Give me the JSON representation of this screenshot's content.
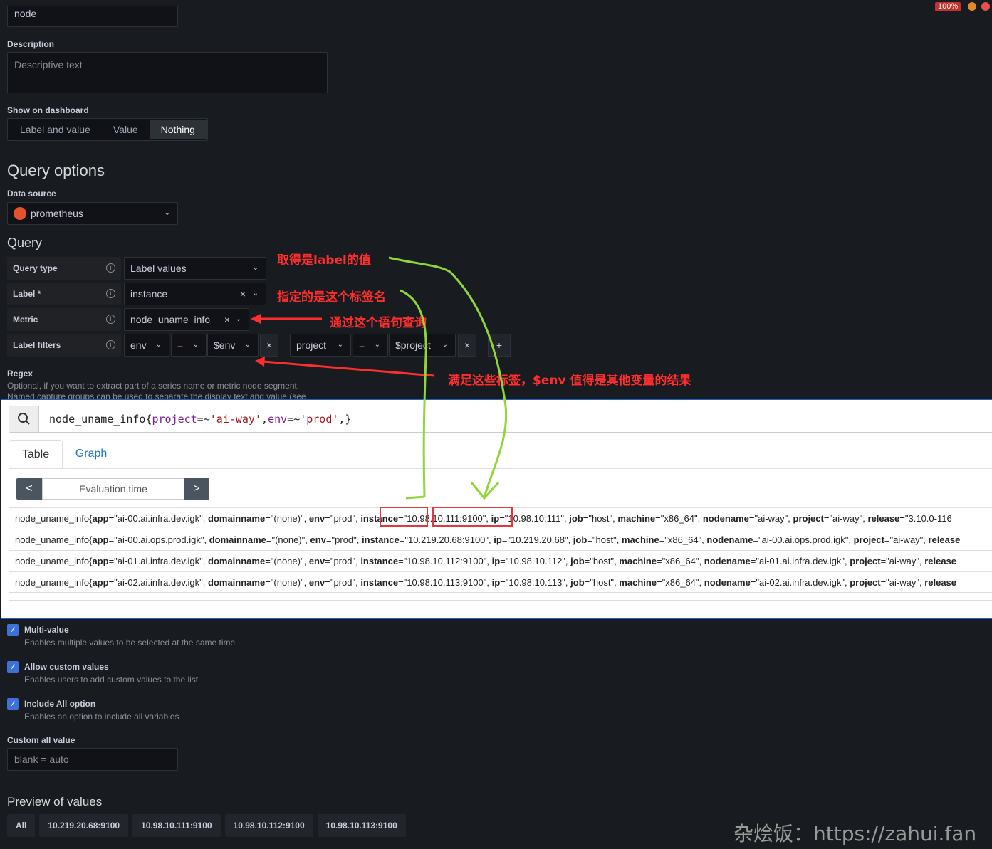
{
  "top": {
    "zoom": "100%",
    "name_value": "node"
  },
  "description": {
    "label": "Description",
    "placeholder": "Descriptive text"
  },
  "show_on_dashboard": {
    "label": "Show on dashboard",
    "options": [
      "Label and value",
      "Value",
      "Nothing"
    ],
    "selected": "Nothing"
  },
  "query_options": {
    "title": "Query options",
    "datasource_label": "Data source",
    "datasource": "prometheus"
  },
  "query": {
    "title": "Query",
    "rows": [
      {
        "label": "Query type",
        "value": "Label values"
      },
      {
        "label": "Label *",
        "value": "instance"
      },
      {
        "label": "Metric",
        "value": "node_uname_info"
      },
      {
        "label": "Label filters"
      }
    ],
    "filters": [
      {
        "key": "env",
        "op": "=",
        "value": "$env"
      },
      {
        "key": "project",
        "op": "=",
        "value": "$project"
      }
    ],
    "add": "+"
  },
  "regex": {
    "label": "Regex",
    "help": "Optional, if you want to extract part of a series name or metric node segment.",
    "help2": "Named capture groups can be used to separate the display text and value (see"
  },
  "annotations": {
    "a1": "取得是label的值",
    "a2": "指定的是这个标签名",
    "a3": "通过这个语句查询",
    "a4": "满足这些标签，$env 值得是其他变量的结果"
  },
  "explorer": {
    "query_metric": "node_uname_info{",
    "query_k1": "project",
    "query_op1": "=~",
    "query_v1": "'ai-way'",
    "query_sep": ",",
    "query_k2": "env",
    "query_op2": "=~",
    "query_v2": "'prod'",
    "query_end": ",}",
    "tabs": [
      "Table",
      "Graph"
    ],
    "eval_time": "Evaluation time",
    "prev": "<",
    "next": ">",
    "rows": [
      {
        "metric": "node_uname_info{",
        "app": "\"ai-00.ai.infra.dev.igk\"",
        "domainname": "\"(none)\"",
        "env": "\"prod\"",
        "instance": "\"10.98.10.111:9100\"",
        "ip": "\"10.98.10.111\"",
        "job": "\"host\"",
        "machine": "\"x86_64\"",
        "nodename": "\"ai-way\"",
        "project": "\"ai-way\"",
        "release": "\"3.10.0-116"
      },
      {
        "metric": "node_uname_info{",
        "app": "\"ai-00.ai.ops.prod.igk\"",
        "domainname": "\"(none)\"",
        "env": "\"prod\"",
        "instance": "\"10.219.20.68:9100\"",
        "ip": "\"10.219.20.68\"",
        "job": "\"host\"",
        "machine": "\"x86_64\"",
        "nodename": "\"ai-00.ai.ops.prod.igk\"",
        "project": "\"ai-way\"",
        "release": ""
      },
      {
        "metric": "node_uname_info{",
        "app": "\"ai-01.ai.infra.dev.igk\"",
        "domainname": "\"(none)\"",
        "env": "\"prod\"",
        "instance": "\"10.98.10.112:9100\"",
        "ip": "\"10.98.10.112\"",
        "job": "\"host\"",
        "machine": "\"x86_64\"",
        "nodename": "\"ai-01.ai.infra.dev.igk\"",
        "project": "\"ai-way\"",
        "release": ""
      },
      {
        "metric": "node_uname_info{",
        "app": "\"ai-02.ai.infra.dev.igk\"",
        "domainname": "\"(none)\"",
        "env": "\"prod\"",
        "instance": "\"10.98.10.113:9100\"",
        "ip": "\"10.98.10.113\"",
        "job": "\"host\"",
        "machine": "\"x86_64\"",
        "nodename": "\"ai-02.ai.infra.dev.igk\"",
        "project": "\"ai-way\"",
        "release": ""
      }
    ]
  },
  "options": [
    {
      "label": "Multi-value",
      "desc": "Enables multiple values to be selected at the same time"
    },
    {
      "label": "Allow custom values",
      "desc": "Enables users to add custom values to the list"
    },
    {
      "label": "Include All option",
      "desc": "Enables an option to include all variables"
    }
  ],
  "custom_all": {
    "label": "Custom all value",
    "placeholder": "blank = auto"
  },
  "preview": {
    "title": "Preview of values",
    "values": [
      "All",
      "10.219.20.68:9100",
      "10.98.10.111:9100",
      "10.98.10.112:9100",
      "10.98.10.113:9100"
    ]
  },
  "watermark": "杂烩饭：https://zahui.fan",
  "colors": {
    "accent": "#3d71d9",
    "annotation": "#ff2e2e",
    "arrow": "#8fd63a",
    "redbox": "#e8343a"
  }
}
